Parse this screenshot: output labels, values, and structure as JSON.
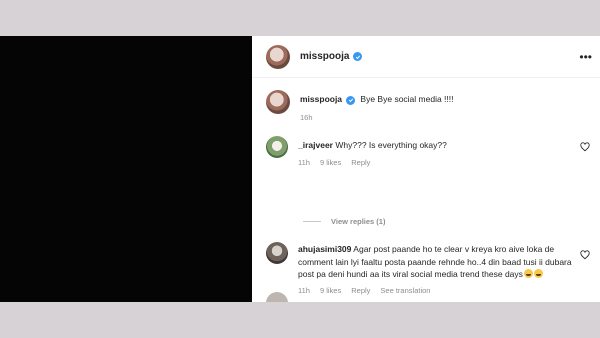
{
  "post": {
    "username": "misspooja",
    "caption": "Bye Bye social media !!!!",
    "time": "16h"
  },
  "header": {
    "username": "misspooja",
    "more_glyph": "•••"
  },
  "comments": [
    {
      "username": "_irajveer",
      "text": "Why??? Is everything okay??",
      "time": "11h",
      "likes": "9 likes",
      "reply_label": "Reply"
    },
    {
      "username": "ahujasimi309",
      "text": "Agar post paande ho te clear v kreya kro aive loka de comment lain lyi faaltu posta paande rehnde ho..4 din baad tusi ii dubara post pa deni hundi aa its viral social media trend these days",
      "time": "11h",
      "likes": "9 likes",
      "reply_label": "Reply",
      "translation_label": "See translation"
    }
  ],
  "view_replies": "View replies (1)",
  "icons": {
    "verified": "verified-badge-icon",
    "heart": "heart-outline-icon",
    "emoji": "grinning-face-icon"
  },
  "colors": {
    "verified": "#3897f0",
    "muted_text": "#8e8e8e",
    "text": "#262626"
  }
}
